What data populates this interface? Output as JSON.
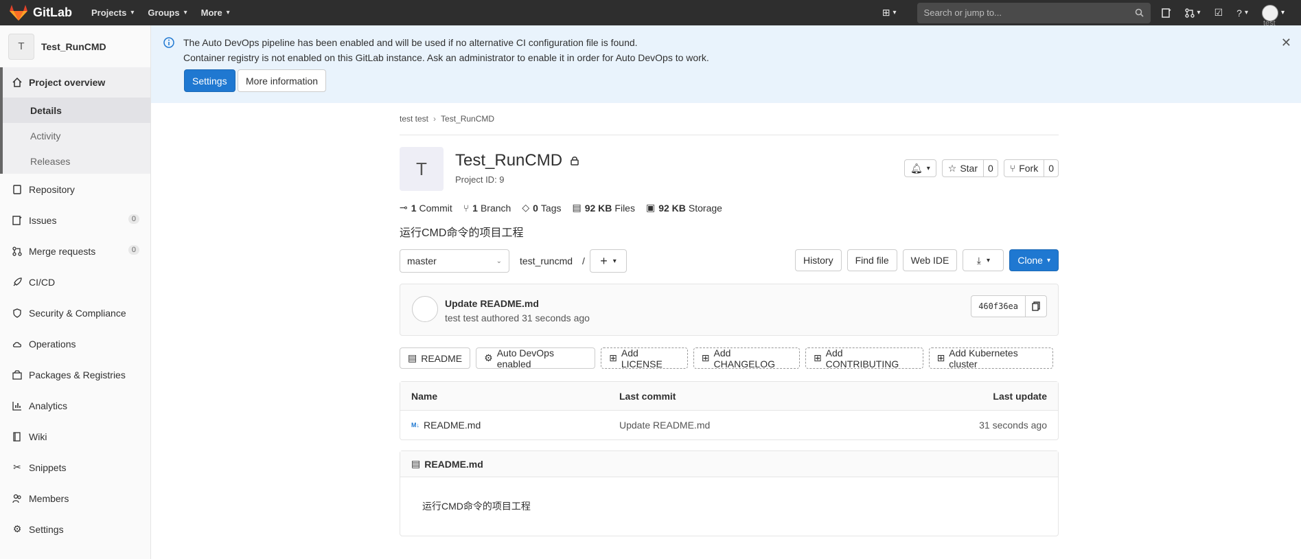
{
  "topbar": {
    "app_name": "GitLab",
    "menus": [
      "Projects",
      "Groups",
      "More"
    ],
    "search_placeholder": "Search or jump to...",
    "user_alt": "test"
  },
  "sidebar": {
    "project_initial": "T",
    "project_name": "Test_RunCMD",
    "overview": "Project overview",
    "subitems": [
      "Details",
      "Activity",
      "Releases"
    ],
    "items": [
      {
        "label": "Repository",
        "icon": "book-icon"
      },
      {
        "label": "Issues",
        "icon": "issues-icon",
        "count": "0"
      },
      {
        "label": "Merge requests",
        "icon": "merge-request-icon",
        "count": "0"
      },
      {
        "label": "CI/CD",
        "icon": "rocket-icon"
      },
      {
        "label": "Security & Compliance",
        "icon": "shield-icon"
      },
      {
        "label": "Operations",
        "icon": "cloud-gear-icon"
      },
      {
        "label": "Packages & Registries",
        "icon": "package-icon"
      },
      {
        "label": "Analytics",
        "icon": "chart-icon"
      },
      {
        "label": "Wiki",
        "icon": "wiki-icon"
      },
      {
        "label": "Snippets",
        "icon": "scissors-icon"
      },
      {
        "label": "Members",
        "icon": "users-icon"
      },
      {
        "label": "Settings",
        "icon": "gear-icon"
      }
    ]
  },
  "banner": {
    "line1": "The Auto DevOps pipeline has been enabled and will be used if no alternative CI configuration file is found.",
    "line2": "Container registry is not enabled on this GitLab instance. Ask an administrator to enable it in order for Auto DevOps to work.",
    "settings_btn": "Settings",
    "more_btn": "More information"
  },
  "breadcrumb": [
    "test test",
    "Test_RunCMD"
  ],
  "project": {
    "initial": "T",
    "title": "Test_RunCMD",
    "id_text": "Project ID: 9",
    "star_label": "Star",
    "star_count": "0",
    "fork_label": "Fork",
    "fork_count": "0",
    "description": "运行CMD命令的项目工程"
  },
  "stats": [
    {
      "num": "1",
      "label": "Commit"
    },
    {
      "num": "1",
      "label": "Branch"
    },
    {
      "num": "0",
      "label": "Tags"
    },
    {
      "num": "92 KB",
      "label": "Files"
    },
    {
      "num": "92 KB",
      "label": "Storage"
    }
  ],
  "tree": {
    "branch": "master",
    "path": "test_runcmd",
    "path_sep": "/",
    "history": "History",
    "find_file": "Find file",
    "web_ide": "Web IDE",
    "clone": "Clone"
  },
  "commit": {
    "title": "Update README.md",
    "meta": "test test authored 31 seconds ago",
    "sha": "460f36ea"
  },
  "pills": [
    {
      "label": "README",
      "dashed": false,
      "icon": "file-icon"
    },
    {
      "label": "Auto DevOps enabled",
      "dashed": false,
      "icon": "gear-icon"
    },
    {
      "label": "Add LICENSE",
      "dashed": true,
      "icon": "plus-square-icon"
    },
    {
      "label": "Add CHANGELOG",
      "dashed": true,
      "icon": "plus-square-icon"
    },
    {
      "label": "Add CONTRIBUTING",
      "dashed": true,
      "icon": "plus-square-icon"
    },
    {
      "label": "Add Kubernetes cluster",
      "dashed": true,
      "icon": "plus-square-icon"
    }
  ],
  "files": {
    "headers": [
      "Name",
      "Last commit",
      "Last update"
    ],
    "rows": [
      {
        "name": "README.md",
        "commit": "Update README.md",
        "updated": "31 seconds ago"
      }
    ]
  },
  "readme": {
    "title": "README.md",
    "content": "运行CMD命令的项目工程"
  },
  "colors": {
    "topbar": "#2e2e2e",
    "primary": "#1f78d1",
    "banner": "#e9f3fc"
  }
}
